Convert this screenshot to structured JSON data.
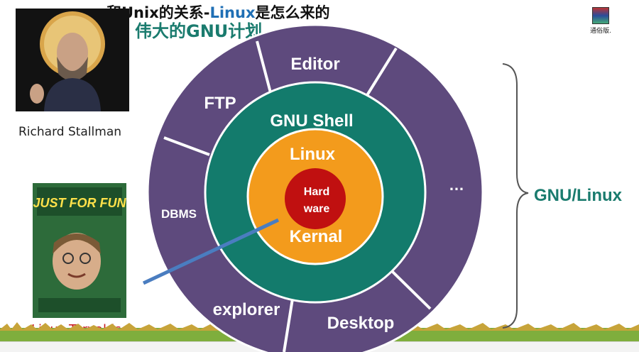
{
  "slide": {
    "title_part1": "和Unix的关系-",
    "title_part2": "Linux",
    "title_part3": "是怎么来的",
    "subtitle": "伟大的GNU计划"
  },
  "photos": {
    "stallman_caption": "Richard   Stallman",
    "torvalds_caption": "Linus Torvalds",
    "book_title": "JUST FOR FUN"
  },
  "desktop_icon": {
    "label": "通俗版."
  },
  "diagram": {
    "outer_ring": [
      "Editor",
      "FTP",
      "DBMS",
      "explorer",
      "Desktop",
      "…"
    ],
    "middle_ring": "GNU Shell",
    "inner_top": "Linux",
    "inner_bottom": "Kernal",
    "core_line1": "Hard",
    "core_line2": "ware",
    "brace_label": "GNU/Linux"
  },
  "colors": {
    "outer": "#5e4a7d",
    "middle": "#137b6c",
    "inner": "#f39b1c",
    "core": "#c01010",
    "label_green": "#1a7b6e",
    "pointer": "#4a7dc0"
  }
}
